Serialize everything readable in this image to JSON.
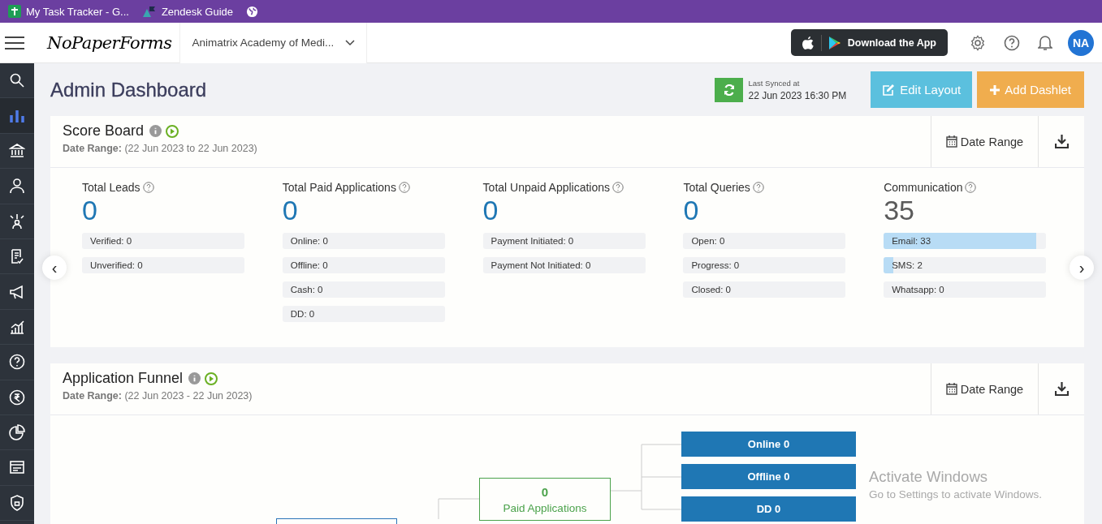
{
  "bookmarks": [
    {
      "label": "My Task Tracker - G..."
    },
    {
      "label": "Zendesk Guide"
    }
  ],
  "header": {
    "logo": "NoPaperForms",
    "institute": "Animatrix Academy of Medi...",
    "download_app": "Download the App",
    "avatar": "NA"
  },
  "sidebar": {
    "items": [
      {
        "selected": false
      },
      {
        "selected": true
      },
      {
        "selected": false
      },
      {
        "selected": false
      },
      {
        "selected": false
      },
      {
        "selected": false
      },
      {
        "selected": false
      },
      {
        "selected": false
      },
      {
        "selected": false
      },
      {
        "selected": false
      },
      {
        "selected": false
      },
      {
        "selected": false
      },
      {
        "selected": false
      }
    ]
  },
  "page": {
    "title": "Admin Dashboard",
    "sync_label": "Last Synced at",
    "sync_time": "22 Jun 2023 16:30 PM",
    "edit_layout": "Edit Layout",
    "add_dashlet": "Add Dashlet"
  },
  "score_board": {
    "title": "Score Board",
    "date_label": "Date Range:",
    "date_value": "(22 Jun 2023 to 22 Jun 2023)",
    "date_button": "Date Range",
    "prev_arrow": "‹",
    "next_arrow": "›",
    "metrics": [
      {
        "label": "Total Leads",
        "value": "0",
        "color": "#1f77b4",
        "items": [
          {
            "text": "Verified: 0"
          },
          {
            "text": "Unverified: 0"
          }
        ]
      },
      {
        "label": "Total Paid Applications",
        "value": "0",
        "color": "#1f77b4",
        "items": [
          {
            "text": "Online: 0"
          },
          {
            "text": "Offline: 0"
          },
          {
            "text": "Cash: 0"
          },
          {
            "text": "DD: 0"
          }
        ]
      },
      {
        "label": "Total Unpaid Applications",
        "value": "0",
        "color": "#1f77b4",
        "items": [
          {
            "text": "Payment Initiated: 0"
          },
          {
            "text": "Payment Not Initiated: 0"
          }
        ]
      },
      {
        "label": "Total Queries",
        "value": "0",
        "color": "#1f77b4",
        "items": [
          {
            "text": "Open: 0"
          },
          {
            "text": "Progress: 0"
          },
          {
            "text": "Closed: 0"
          }
        ]
      },
      {
        "label": "Communication",
        "value": "35",
        "color": "#5a5a5a",
        "items": [
          {
            "text": "Email: 33",
            "level": 0.94
          },
          {
            "text": "SMS: 2",
            "level": 0.06
          },
          {
            "text": "Whatsapp: 0"
          }
        ]
      }
    ]
  },
  "application_funnel": {
    "title": "Application Funnel",
    "date_label": "Date Range:",
    "date_value": "(22 Jun 2023 - 22 Jun 2023)",
    "date_button": "Date Range",
    "paid_node": {
      "value": "0",
      "label": "Paid Applications"
    },
    "leaves": [
      {
        "label": "Online",
        "value": "0"
      },
      {
        "label": "Offline",
        "value": "0"
      },
      {
        "label": "DD",
        "value": "0"
      }
    ]
  },
  "os_notice": {
    "title": "Activate Windows",
    "text": "Go to Settings to activate Windows."
  }
}
